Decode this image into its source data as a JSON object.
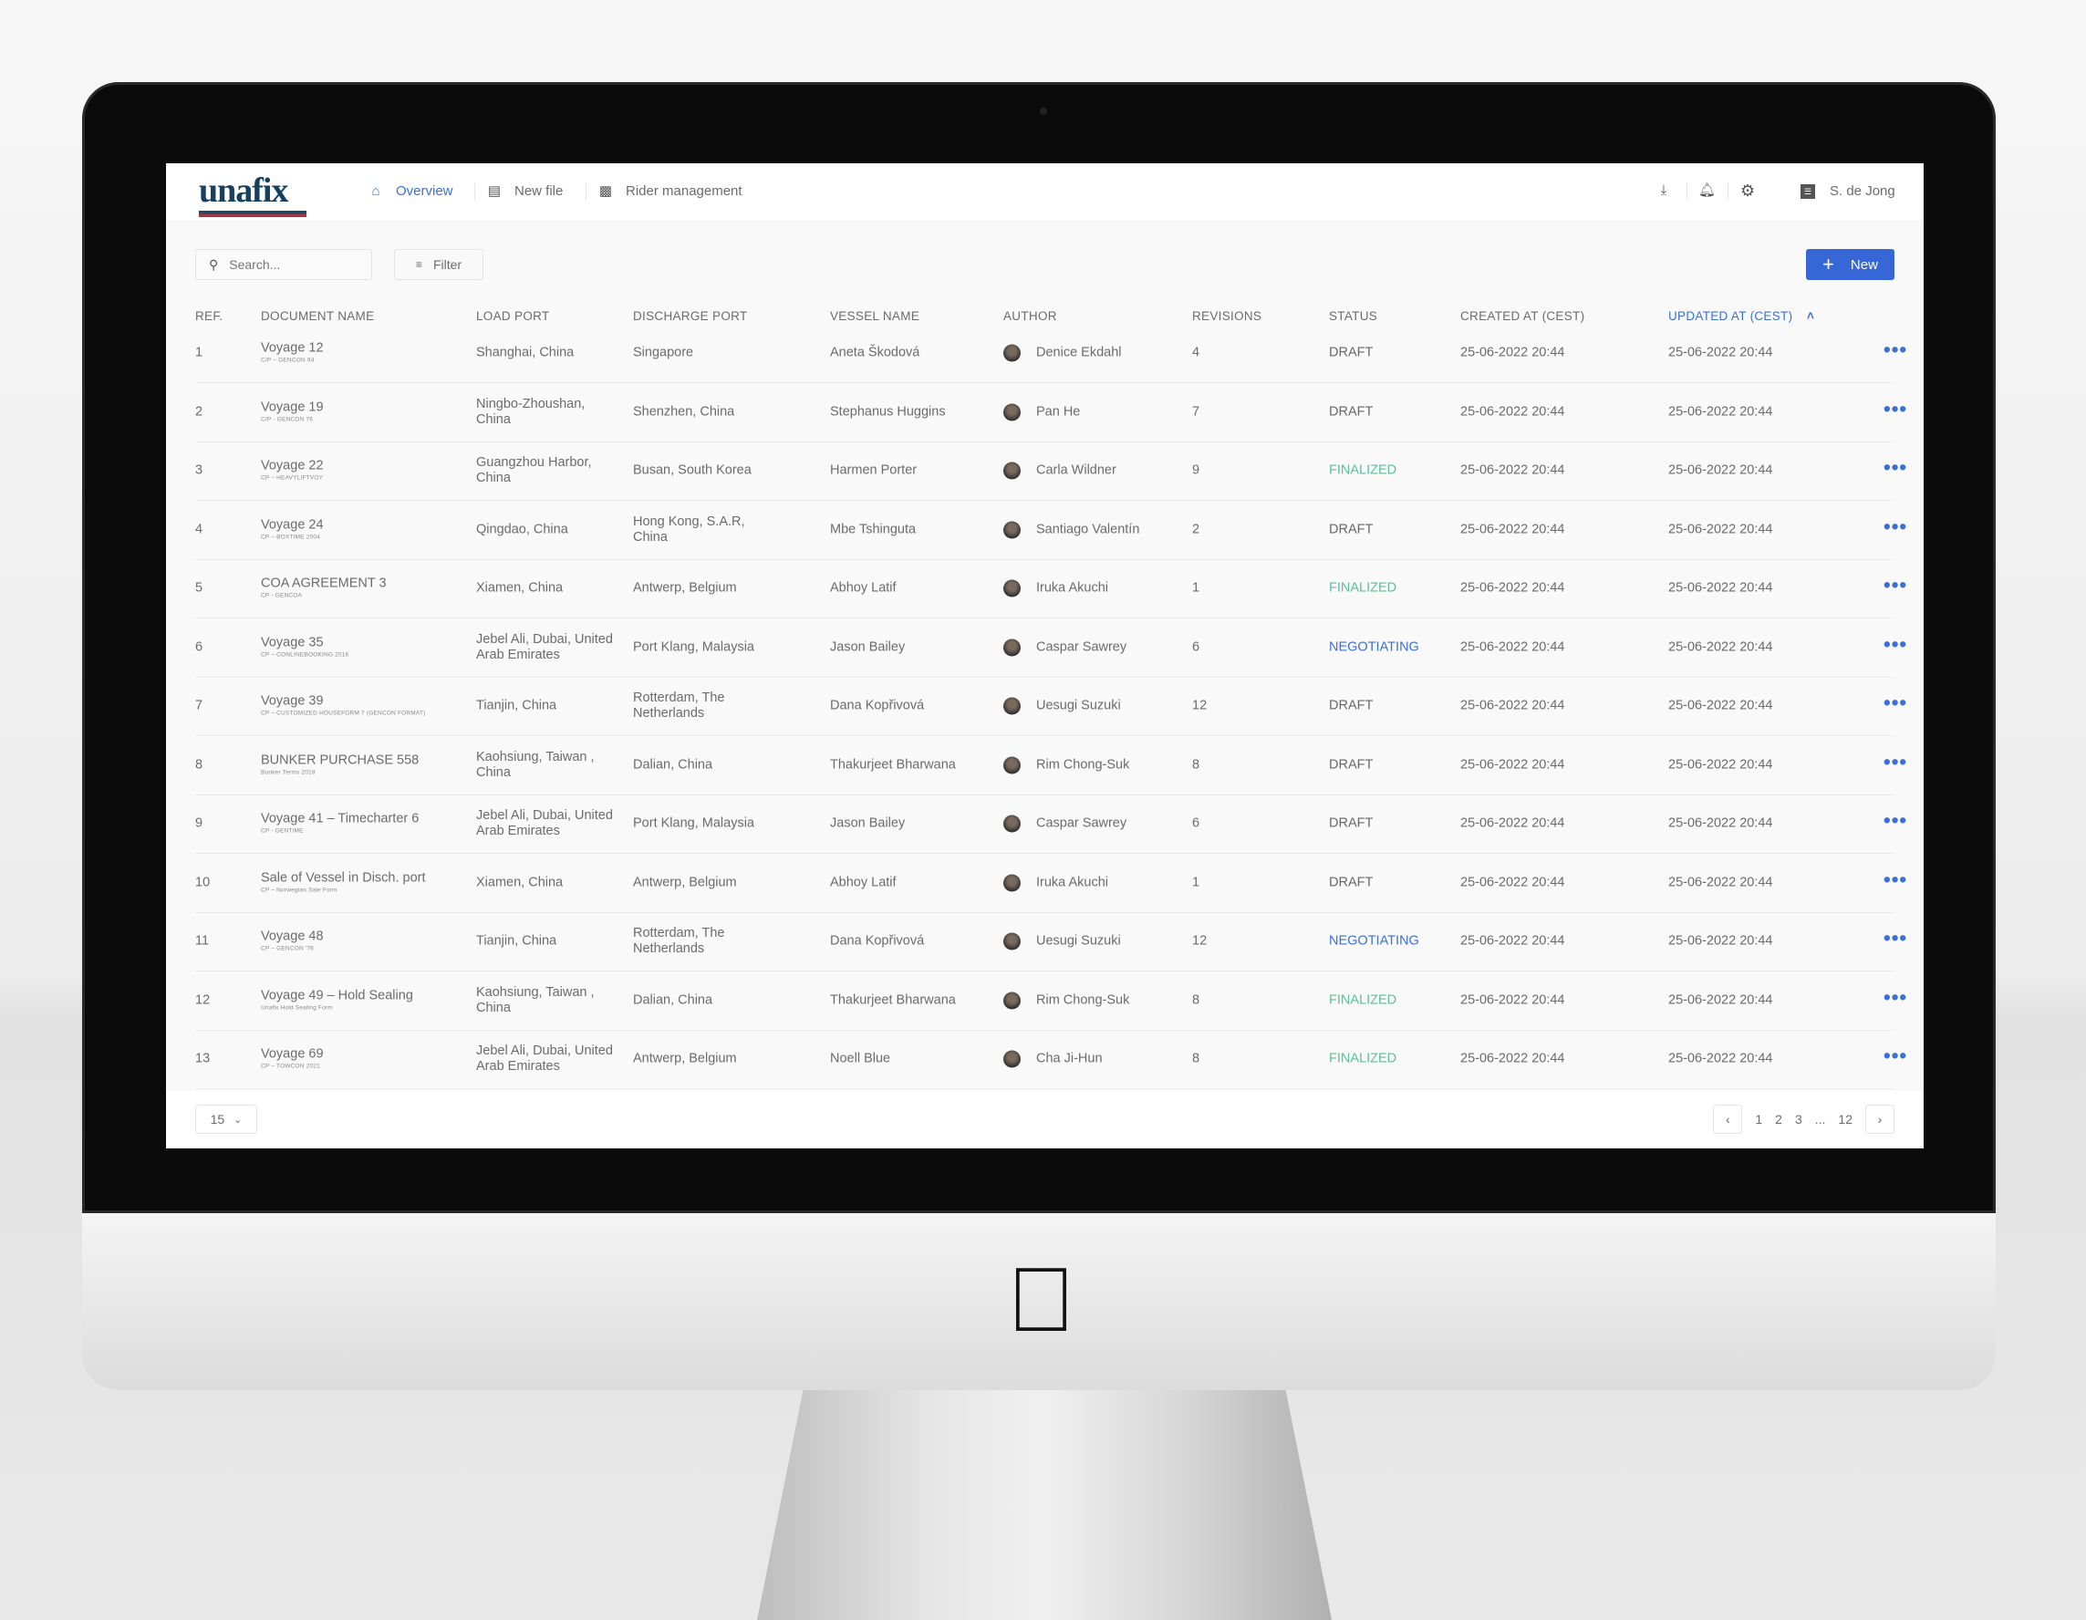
{
  "app": {
    "logo": "unafix",
    "user": "S. de Jong"
  },
  "nav": [
    {
      "label": "Overview",
      "icon": "home-icon",
      "active": true
    },
    {
      "label": "New file",
      "icon": "document-icon"
    },
    {
      "label": "Rider management",
      "icon": "rider-icon"
    }
  ],
  "toolbar": {
    "search_placeholder": "Search...",
    "filter_label": "Filter",
    "new_label": "New"
  },
  "columns": [
    "REF.",
    "DOCUMENT NAME",
    "LOAD PORT",
    "DISCHARGE PORT",
    "VESSEL NAME",
    "AUTHOR",
    "REVISIONS",
    "STATUS",
    "CREATED AT (CEST)",
    "UPDATED AT (CEST)"
  ],
  "sorted_column": "UPDATED AT (CEST)",
  "status_colors": {
    "DRAFT": "#666666",
    "FINALIZED": "#5bbf98",
    "NEGOTIATING": "#3a6fd8"
  },
  "rows": [
    {
      "ref": "1",
      "name": "Voyage 12",
      "sub": "C/P – GENCON 94",
      "load": "Shanghai, China",
      "discharge": "Singapore",
      "vessel": "Aneta Škodová",
      "author": "Denice Ekdahl",
      "revisions": "4",
      "status": "DRAFT",
      "created": "25-06-2022 20:44",
      "updated": "25-06-2022 20:44"
    },
    {
      "ref": "2",
      "name": "Voyage 19",
      "sub": "C/P - GENCON 76",
      "load": "Ningbo-Zhoushan, China",
      "discharge": "Shenzhen, China",
      "vessel": "Stephanus Huggins",
      "author": "Pan He",
      "revisions": "7",
      "status": "DRAFT",
      "created": "25-06-2022 20:44",
      "updated": "25-06-2022 20:44"
    },
    {
      "ref": "3",
      "name": "Voyage 22",
      "sub": "CP – HEAVYLIFTVOY",
      "load": "Guangzhou Harbor, China",
      "discharge": "Busan, South Korea",
      "vessel": "Harmen Porter",
      "author": "Carla Wildner",
      "revisions": "9",
      "status": "FINALIZED",
      "created": "25-06-2022 20:44",
      "updated": "25-06-2022 20:44"
    },
    {
      "ref": "4",
      "name": "Voyage 24",
      "sub": "CP – BOXTIME 2004",
      "load": "Qingdao, China",
      "discharge": "Hong Kong, S.A.R, China",
      "vessel": "Mbe Tshinguta",
      "author": "Santiago Valentín",
      "revisions": "2",
      "status": "DRAFT",
      "created": "25-06-2022 20:44",
      "updated": "25-06-2022 20:44"
    },
    {
      "ref": "5",
      "name": "COA AGREEMENT 3",
      "sub": "CP - GENCOA",
      "load": "Xiamen, China",
      "discharge": "Antwerp, Belgium",
      "vessel": "Abhoy Latif",
      "author": "Iruka Akuchi",
      "revisions": "1",
      "status": "FINALIZED",
      "created": "25-06-2022 20:44",
      "updated": "25-06-2022 20:44"
    },
    {
      "ref": "6",
      "name": "Voyage 35",
      "sub": "CP – CONLINEBOOKING 2016",
      "load": "Jebel Ali, Dubai, United Arab Emirates",
      "discharge": "Port Klang, Malaysia",
      "vessel": "Jason Bailey",
      "author": "Caspar Sawrey",
      "revisions": "6",
      "status": "NEGOTIATING",
      "created": "25-06-2022 20:44",
      "updated": "25-06-2022 20:44"
    },
    {
      "ref": "7",
      "name": "Voyage 39",
      "sub": "CP – CUSTOMIZED HOUSEFORM 7 (GENCON FORMAT)",
      "load": "Tianjin, China",
      "discharge": "Rotterdam, The Netherlands",
      "vessel": "Dana Kopřivová",
      "author": "Uesugi Suzuki",
      "revisions": "12",
      "status": "DRAFT",
      "created": "25-06-2022 20:44",
      "updated": "25-06-2022 20:44"
    },
    {
      "ref": "8",
      "name": "BUNKER PURCHASE 558",
      "sub": "Bunker Terms 2018",
      "load": "Kaohsiung, Taiwan , China",
      "discharge": "Dalian, China",
      "vessel": "Thakurjeet Bharwana",
      "author": "Rim Chong-Suk",
      "revisions": "8",
      "status": "DRAFT",
      "created": "25-06-2022 20:44",
      "updated": "25-06-2022 20:44"
    },
    {
      "ref": "9",
      "name": "Voyage 41 – Timecharter 6",
      "sub": "CP - GENTIME",
      "load": "Jebel Ali, Dubai, United Arab Emirates",
      "discharge": "Port Klang, Malaysia",
      "vessel": "Jason Bailey",
      "author": "Caspar Sawrey",
      "revisions": "6",
      "status": "DRAFT",
      "created": "25-06-2022 20:44",
      "updated": "25-06-2022 20:44"
    },
    {
      "ref": "10",
      "name": "Sale of Vessel in Disch. port",
      "sub": "CP – Norwegian Sale Form",
      "load": "Xiamen, China",
      "discharge": "Antwerp, Belgium",
      "vessel": "Abhoy Latif",
      "author": "Iruka Akuchi",
      "revisions": "1",
      "status": "DRAFT",
      "created": "25-06-2022 20:44",
      "updated": "25-06-2022 20:44"
    },
    {
      "ref": "11",
      "name": "Voyage 48",
      "sub": "CP – GENCON '76",
      "load": "Tianjin, China",
      "discharge": "Rotterdam, The Netherlands",
      "vessel": "Dana Kopřivová",
      "author": "Uesugi Suzuki",
      "revisions": "12",
      "status": "NEGOTIATING",
      "created": "25-06-2022 20:44",
      "updated": "25-06-2022 20:44"
    },
    {
      "ref": "12",
      "name": "Voyage 49 – Hold Sealing",
      "sub": "Unafix Hold Sealing Form",
      "load": "Kaohsiung, Taiwan , China",
      "discharge": "Dalian, China",
      "vessel": "Thakurjeet Bharwana",
      "author": "Rim Chong-Suk",
      "revisions": "8",
      "status": "FINALIZED",
      "created": "25-06-2022 20:44",
      "updated": "25-06-2022 20:44"
    },
    {
      "ref": "13",
      "name": "Voyage 69",
      "sub": "CP – TOWCON 2021",
      "load": "Jebel Ali, Dubai, United Arab Emirates",
      "discharge": "Antwerp, Belgium",
      "vessel": "Noell Blue",
      "author": "Cha Ji-Hun",
      "revisions": "8",
      "status": "FINALIZED",
      "created": "25-06-2022 20:44",
      "updated": "25-06-2022 20:44"
    }
  ],
  "footer": {
    "per_page": "15",
    "pages": [
      "1",
      "2",
      "3",
      "...",
      "12"
    ]
  }
}
